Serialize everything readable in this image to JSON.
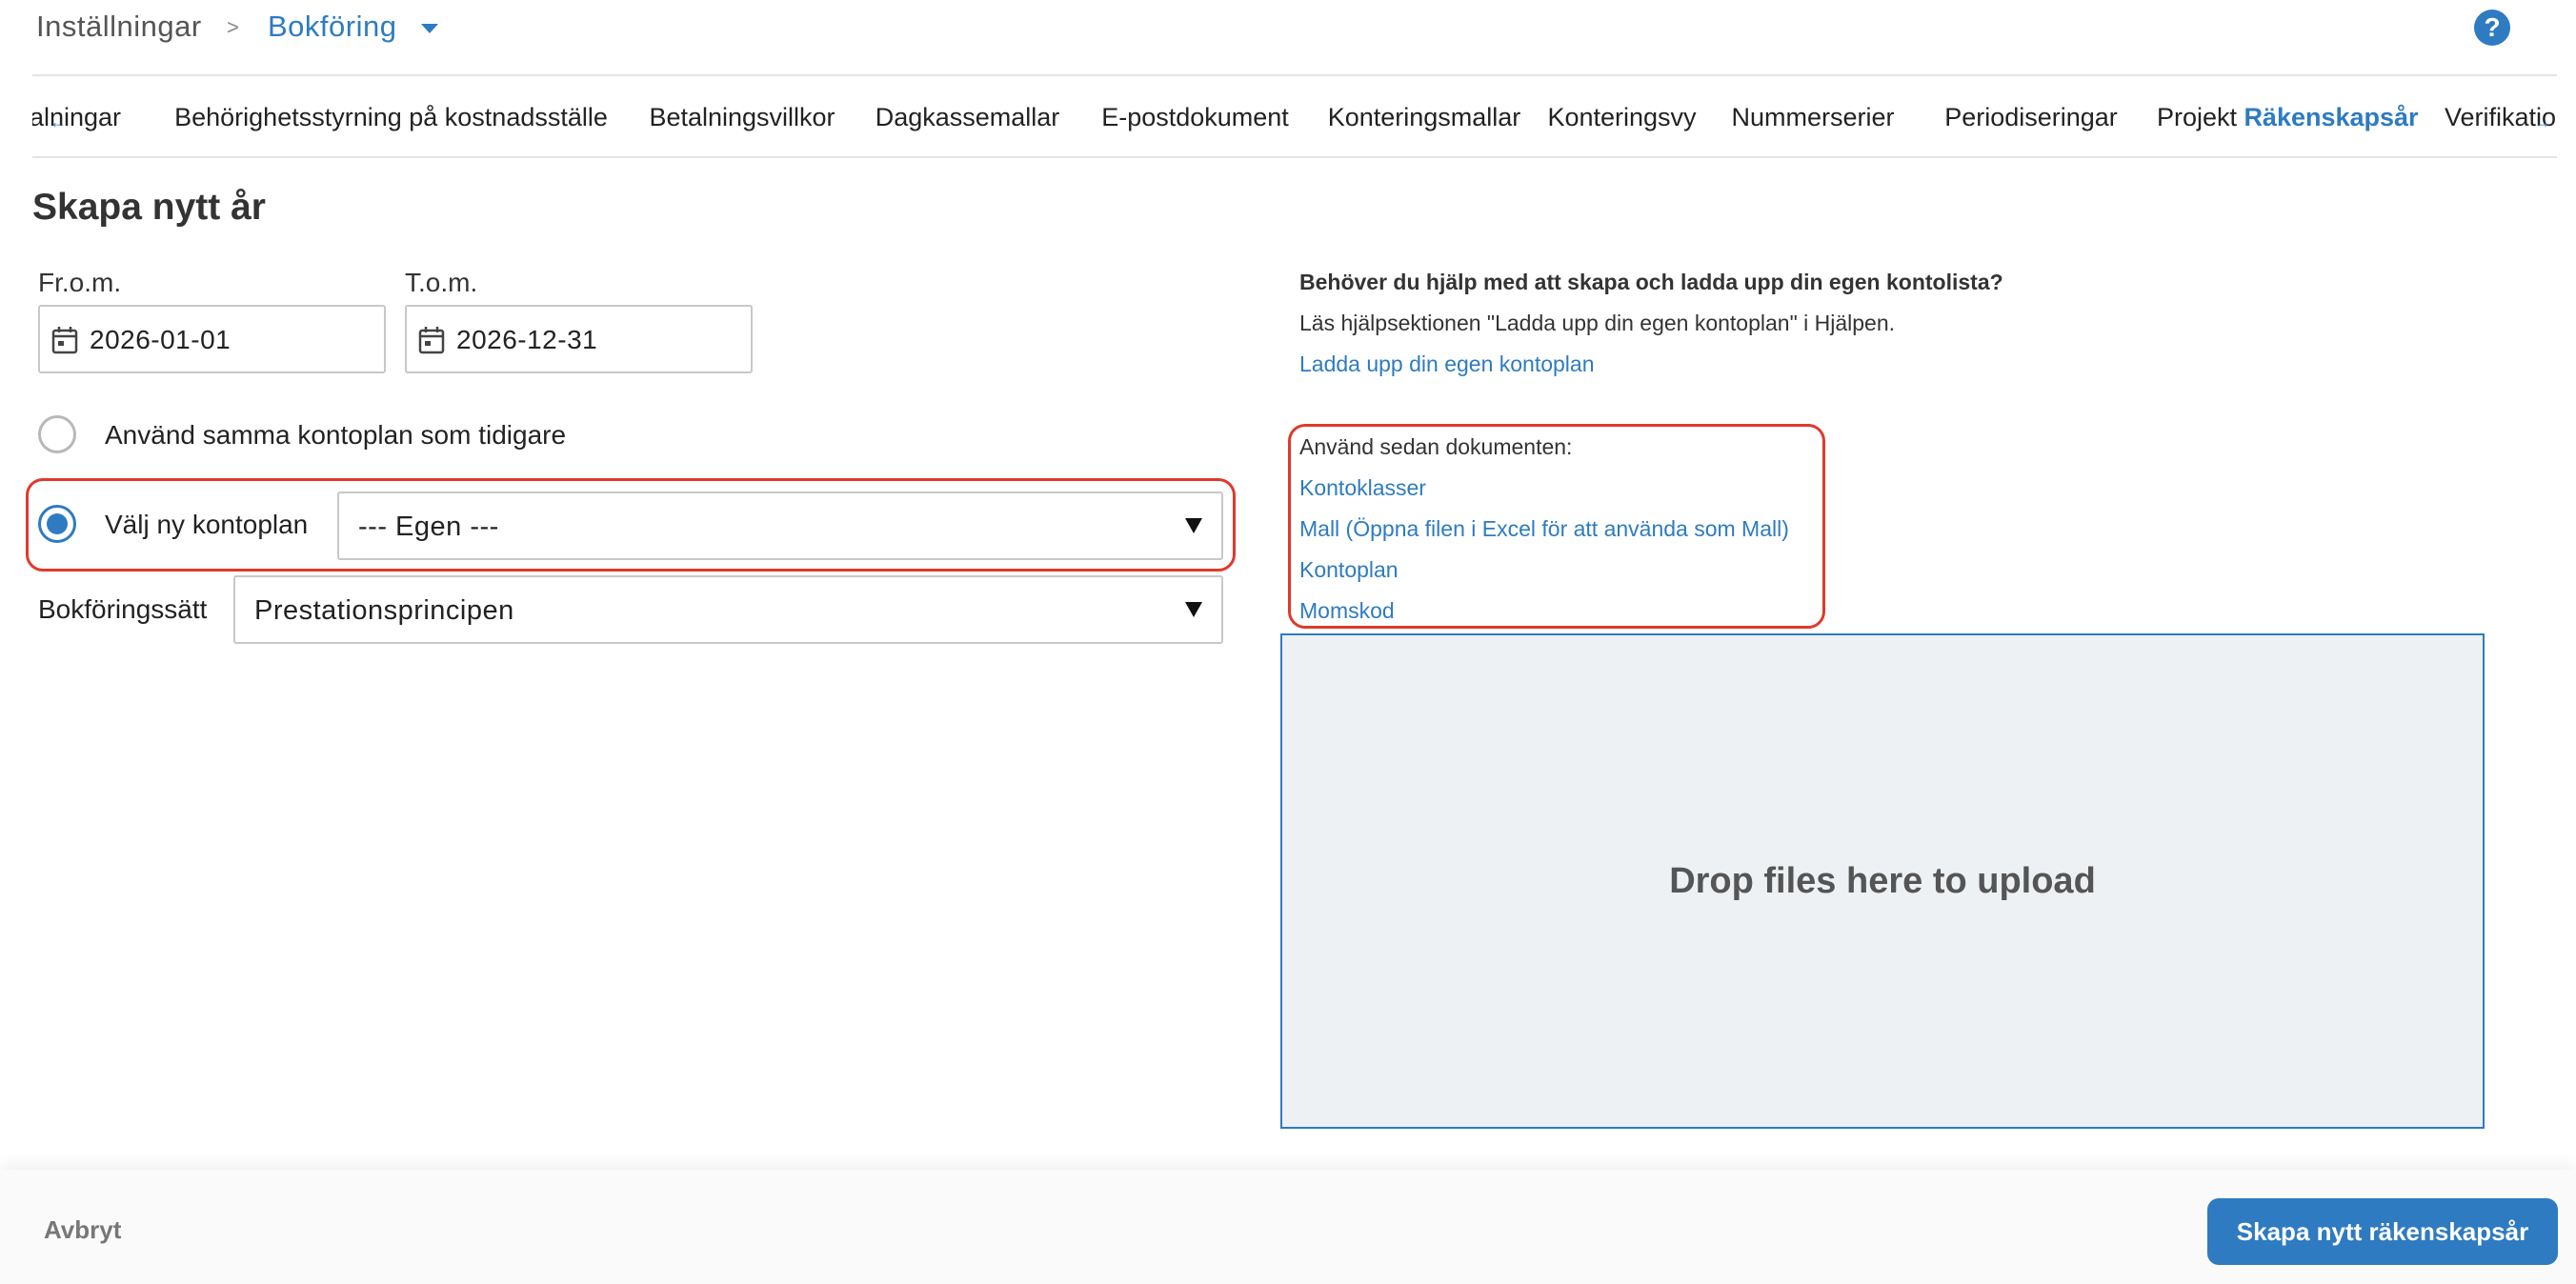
{
  "breadcrumb": {
    "root": "Inställningar",
    "separator": ">",
    "current": "Bokföring"
  },
  "help_icon": "?",
  "tabs": [
    {
      "label": "alningar",
      "active": false
    },
    {
      "label": "Behörighetsstyrning på kostnadsställe",
      "active": false
    },
    {
      "label": "Betalningsvillkor",
      "active": false
    },
    {
      "label": "Dagkassemallar",
      "active": false
    },
    {
      "label": "E-postdokument",
      "active": false
    },
    {
      "label": "Konteringsmallar",
      "active": false
    },
    {
      "label": "Konteringsvy",
      "active": false
    },
    {
      "label": "Nummerserier",
      "active": false
    },
    {
      "label": "Periodiseringar",
      "active": false
    },
    {
      "label": "Projekt",
      "active": false
    },
    {
      "label": "Räkenskapsår",
      "active": true
    },
    {
      "label": "Verifikatio",
      "active": false
    }
  ],
  "tab_scroll_icons": {
    "left": "←",
    "right": "→"
  },
  "form": {
    "title": "Skapa nytt år",
    "from_label": "Fr.o.m.",
    "from_value": "2026-01-01",
    "to_label": "T.o.m.",
    "to_value": "2026-12-31",
    "radio_same_label": "Använd samma kontoplan som tidigare",
    "radio_same_checked": false,
    "radio_new_label": "Välj ny kontoplan",
    "radio_new_checked": true,
    "kontoplan_select_value": "--- Egen ---",
    "bokforingssatt_label": "Bokföringssätt",
    "bokforingssatt_value": "Prestationsprincipen"
  },
  "help": {
    "heading": "Behöver du hjälp med att skapa och ladda upp din egen kontolista?",
    "text": "Läs hjälpsektionen \"Ladda upp din egen kontoplan\" i Hjälpen.",
    "upload_link": "Ladda upp din egen kontoplan",
    "docs_intro": "Använd sedan dokumenten:",
    "docs_links": [
      "Kontoklasser",
      "Mall (Öppna filen i Excel för att använda som Mall)",
      "Kontoplan",
      "Momskod"
    ]
  },
  "dropzone": {
    "text": "Drop files here to upload"
  },
  "footer": {
    "cancel_label": "Avbryt",
    "submit_label": "Skapa nytt räkenskapsår"
  },
  "colors": {
    "accent": "#2e7bc1",
    "highlight": "#e0392b",
    "dropzone_bg": "#edf1f4"
  }
}
